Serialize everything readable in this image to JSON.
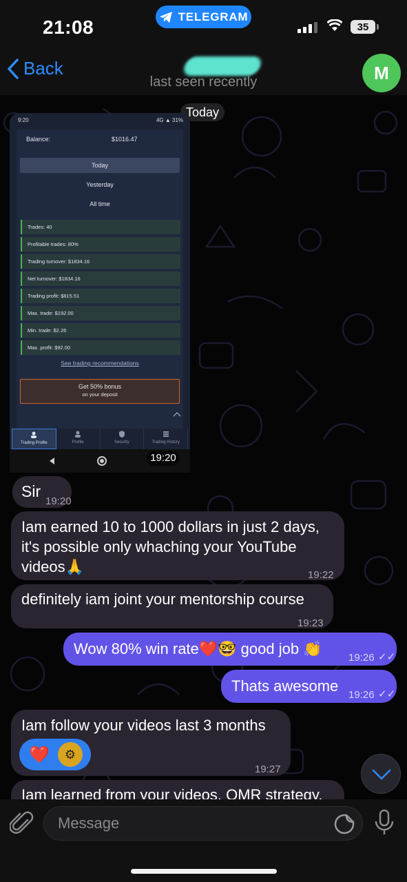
{
  "status_bar": {
    "time": "21:08",
    "app_pill": "TELEGRAM",
    "battery": "35"
  },
  "header": {
    "back_label": "Back",
    "subtitle": "last seen recently",
    "avatar_initial": "M"
  },
  "date_separator": "Today",
  "screenshot": {
    "phone_time": "9:20",
    "phone_status_right": "4G ▲ 31%",
    "balance_label": "Balance:",
    "balance_value": "$1016.47",
    "periods": [
      "Today",
      "Yesterday",
      "All time"
    ],
    "stats": [
      "Trades: 40",
      "Profitable trades: 80%",
      "Trading turnover: $1834.16",
      "Net turnover: $1834.16",
      "Trading profit: $815.51",
      "Max. trade: $192.00",
      "Min. trade: $2.26",
      "Max. profit: $92.00"
    ],
    "recommendations_link": "See trading recommendations",
    "bonus_line1": "Get 50% bonus",
    "bonus_line2": "on your deposit",
    "tabs": [
      "Trading Profile",
      "Profile",
      "Security",
      "Trading History"
    ],
    "time": "19:20"
  },
  "messages": [
    {
      "side": "in",
      "text": "Sir",
      "time": "19:20"
    },
    {
      "side": "in",
      "text": "Iam earned 10 to 1000 dollars in just 2 days, it's possible only whaching your YouTube videos🙏",
      "time": "19:22"
    },
    {
      "side": "in",
      "text": "definitely iam joint your mentorship course",
      "time": "19:23"
    },
    {
      "side": "out",
      "text": "Wow 80% win rate❤️🤓 good job 👏",
      "time": "19:26"
    },
    {
      "side": "out",
      "text": "Thats awesome",
      "time": "19:26"
    },
    {
      "side": "in",
      "text": "Iam follow your videos last 3 months",
      "time": "19:27"
    },
    {
      "side": "in",
      "text": "Iam learned from your videos, QMR strategy,",
      "time": ""
    }
  ],
  "reactions": [
    "❤️",
    "⚙"
  ],
  "input": {
    "placeholder": "Message"
  },
  "colors": {
    "accent": "#2d8cff",
    "outgoing": "#6253e8",
    "incoming": "#2a2530",
    "avatar": "#4fc65a"
  }
}
